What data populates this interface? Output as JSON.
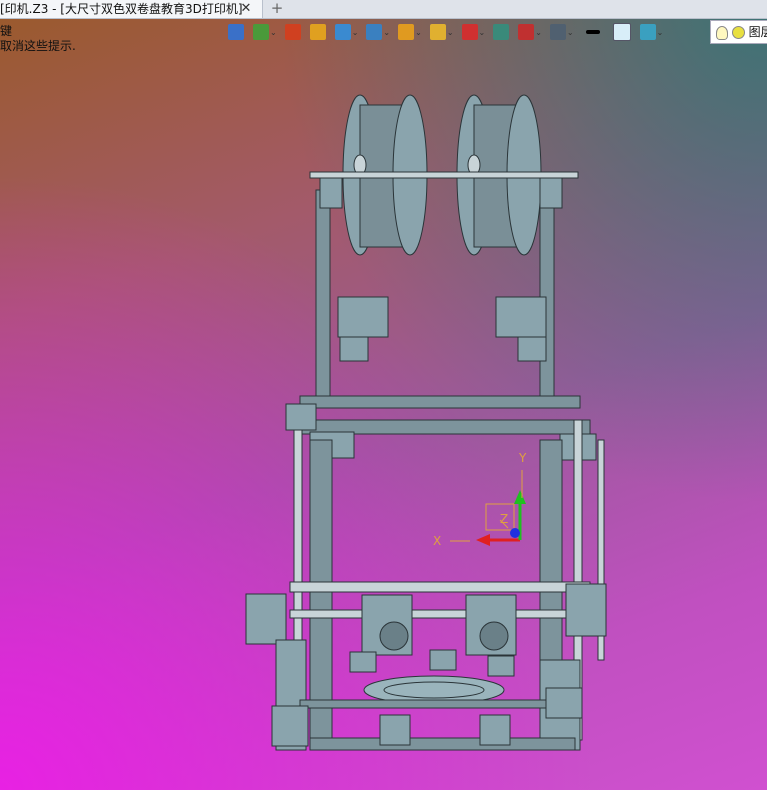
{
  "window": {
    "tab_title": "[印机.Z3 - [大尺寸双色双卷盘教育3D打印机]",
    "tab_close": "✕",
    "tab_add": "+"
  },
  "hints": {
    "line1": "键",
    "line2": "取消这些提示."
  },
  "toolbar": {
    "items": [
      {
        "icon": "exit-sketch-icon",
        "color": "#3a70c8"
      },
      {
        "icon": "workplane-icon",
        "color": "#4a9a3a",
        "dropdown": true
      },
      {
        "icon": "pen-tool-icon",
        "color": "#d04020"
      },
      {
        "icon": "face-icon",
        "color": "#e0a020"
      },
      {
        "icon": "solid-box-icon",
        "color": "#3a8ad0",
        "dropdown": true
      },
      {
        "icon": "copy-shape-icon",
        "color": "#3a80c0",
        "dropdown": true
      },
      {
        "icon": "snap-icon",
        "color": "#e09a20",
        "dropdown": true
      },
      {
        "icon": "zoom-icon",
        "color": "#e0b030",
        "dropdown": true
      },
      {
        "icon": "rotate-view-icon",
        "color": "#d03030",
        "dropdown": true
      },
      {
        "icon": "view-fit-icon",
        "color": "#3a8a7a"
      },
      {
        "icon": "section-icon",
        "color": "#c03030",
        "dropdown": true
      },
      {
        "icon": "display-icon",
        "color": "#506070",
        "dropdown": true
      },
      {
        "icon": "line-color-icon",
        "color": "#000000"
      },
      {
        "icon": "face-color-icon",
        "color": "#d8eef8"
      },
      {
        "icon": "layers-icon",
        "color": "#3aa0c0",
        "dropdown": true
      }
    ],
    "dropdown_glyph": "⌄"
  },
  "right_control": {
    "label": "图层"
  },
  "triad": {
    "x_label": "X",
    "y_label": "Y",
    "z_label": "Z"
  },
  "colors": {
    "model_fill": "#8aa4ad",
    "model_edge": "#2a3438",
    "axis_x": "#e02020",
    "axis_y": "#20c020",
    "axis_z": "#2030e0",
    "axis_label": "#e0a040"
  }
}
